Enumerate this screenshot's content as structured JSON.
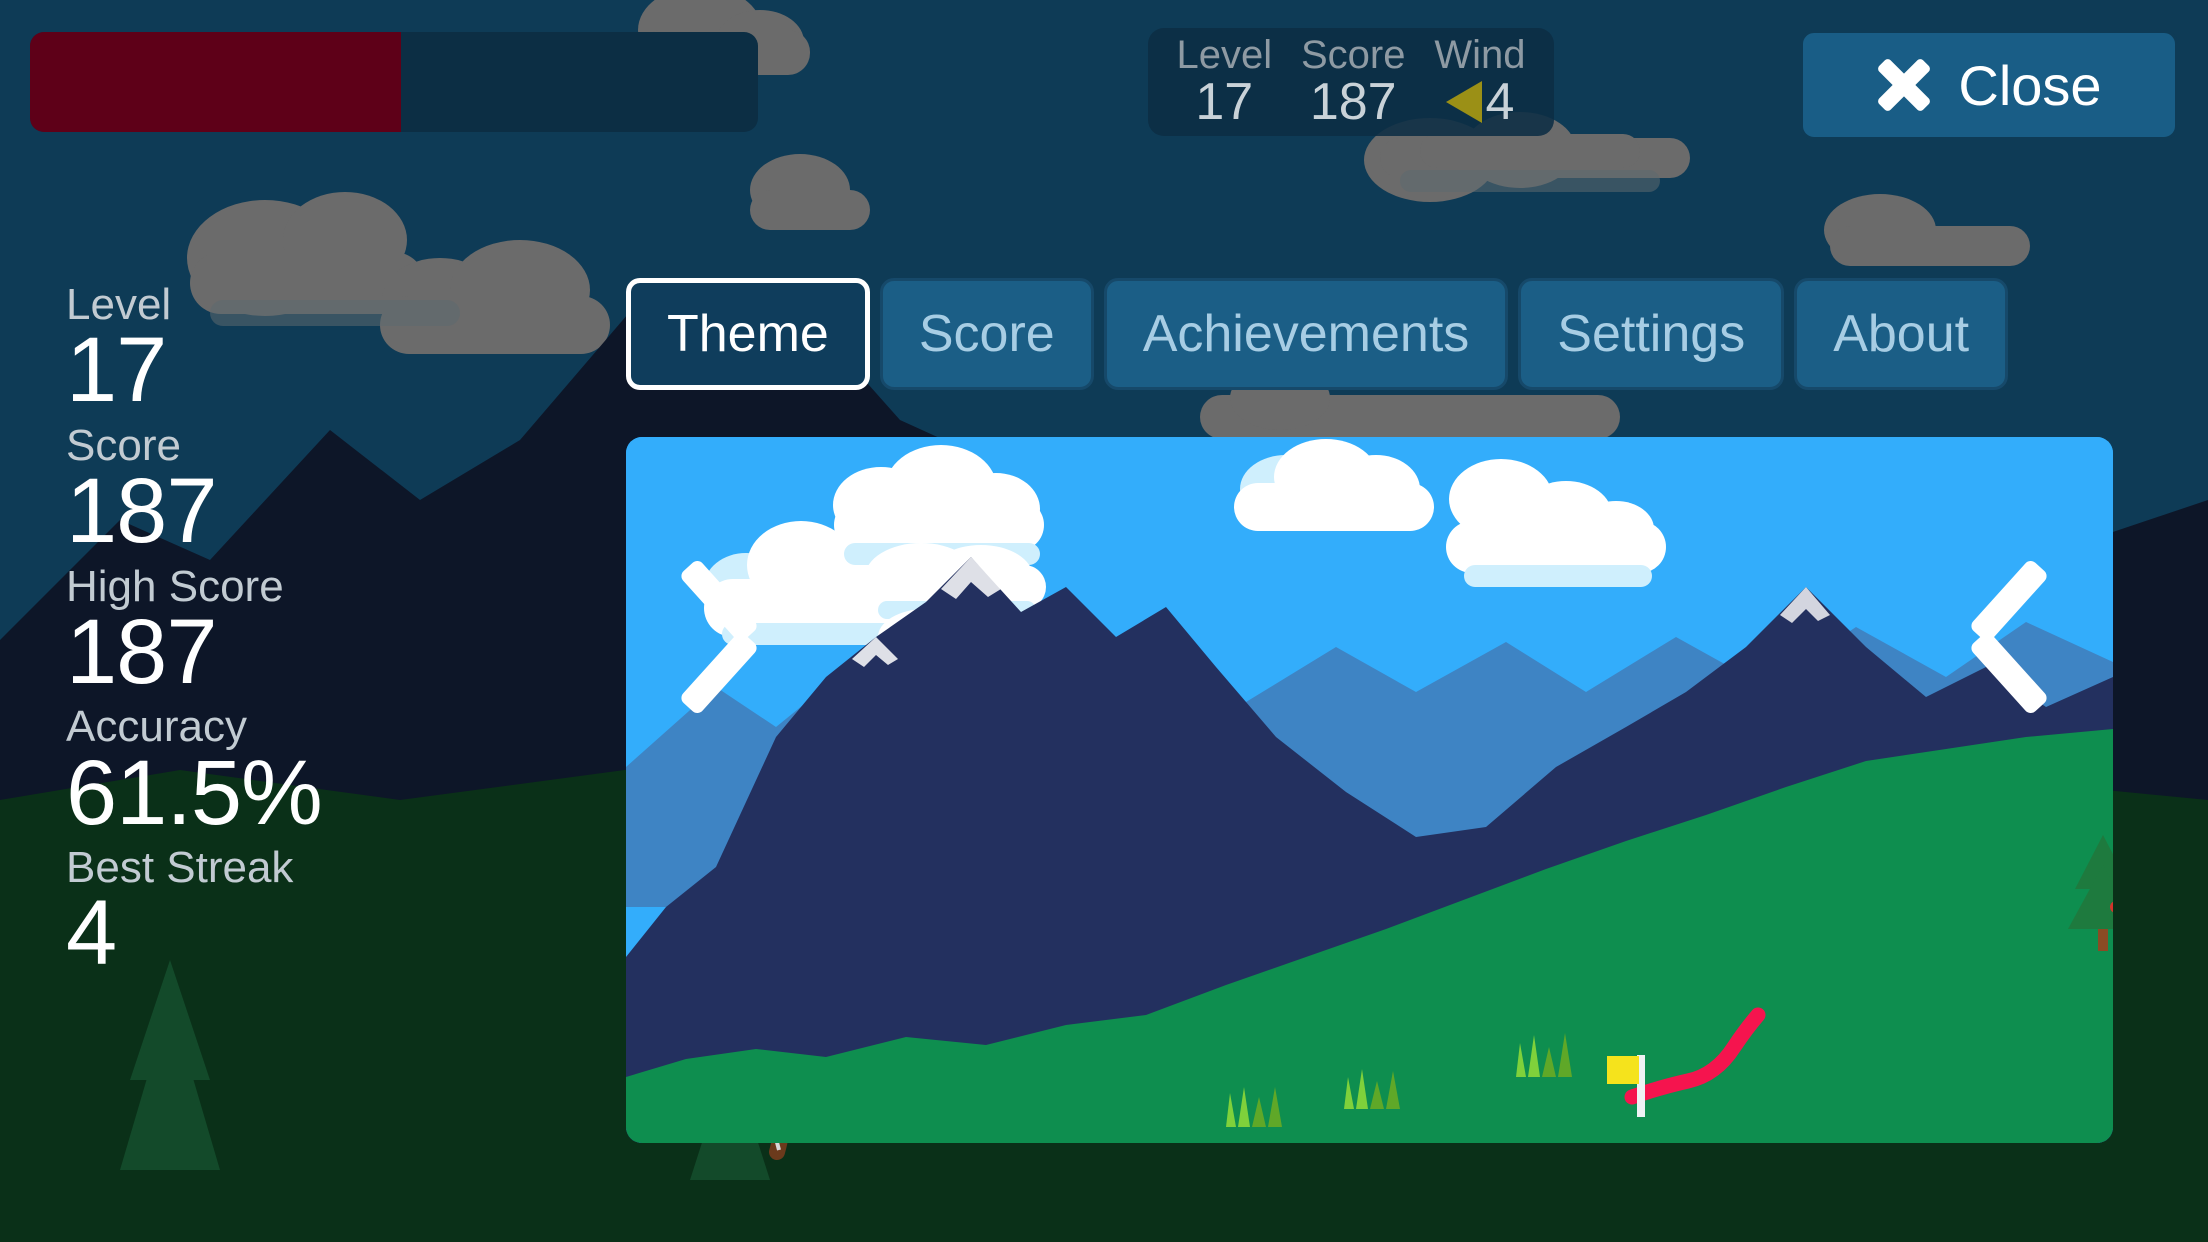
{
  "app": {
    "scene_theme": "night-mountains",
    "colors": {
      "bg_sky": "#0E3B56",
      "bg_mountain": "#0D1628",
      "bg_ground": "#0A3018",
      "bg_cloud": "#6B6B6B",
      "panel": "#0C2E44",
      "tab": "#1B5E86",
      "tab_active": "#0F3D5C",
      "accent_button": "#195D86",
      "progress_fill": "#5E0018",
      "wind_arrow": "#9B9016",
      "preview_sky": "#33ADFB",
      "preview_mountain": "#23305F",
      "preview_mountain_far": "#3E84C4",
      "preview_grass": "#0E8E4F",
      "trajectory": "#F5144E",
      "flag": "#F5E31C"
    }
  },
  "progress": {
    "percent": 51,
    "label": ""
  },
  "hud": {
    "cells": [
      {
        "label": "Level",
        "value": "17"
      },
      {
        "label": "Score",
        "value": "187"
      },
      {
        "label": "Wind",
        "value": "4",
        "direction": "left"
      }
    ]
  },
  "close_button": {
    "label": "Close",
    "icon": "close-x-icon"
  },
  "stats": [
    {
      "label": "Level",
      "value": "17"
    },
    {
      "label": "Score",
      "value": "187"
    },
    {
      "label": "High Score",
      "value": "187"
    },
    {
      "label": "Accuracy",
      "value": "61.5%"
    },
    {
      "label": "Best Streak",
      "value": "4"
    }
  ],
  "tabs": [
    {
      "label": "Theme",
      "active": true
    },
    {
      "label": "Score",
      "active": false
    },
    {
      "label": "Achievements",
      "active": false
    },
    {
      "label": "Settings",
      "active": false
    },
    {
      "label": "About",
      "active": false
    }
  ],
  "preview": {
    "prev_arrow_icon": "chevron-left-icon",
    "next_arrow_icon": "chevron-right-icon",
    "scene_elements": [
      "sky",
      "clouds",
      "far-mountains",
      "near-mountains",
      "grass-hill",
      "pine-tree",
      "grass-tufts",
      "flag",
      "trajectory",
      "bow"
    ]
  }
}
